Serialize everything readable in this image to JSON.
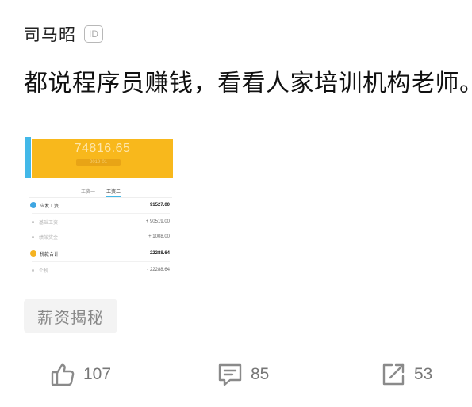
{
  "post": {
    "author": "司马昭",
    "id_badge": "ID",
    "text": "都说程序员赚钱，看看人家培训机构老师。",
    "tag": "薪资揭秘"
  },
  "image": {
    "amount": "74816.65",
    "date": "2019-01",
    "tabs": [
      "工资一",
      "工资二"
    ],
    "rows": [
      {
        "label": "应发工资",
        "value": "91527.00",
        "kind": "main",
        "icon": "blue"
      },
      {
        "label": "基础工资",
        "value": "+ 90519.00",
        "kind": "sub"
      },
      {
        "label": "绩效奖金",
        "value": "+ 1008.00",
        "kind": "sub"
      },
      {
        "label": "税款合计",
        "value": "22288.64",
        "kind": "main",
        "icon": "gold"
      },
      {
        "label": "个税",
        "value": "- 22288.64",
        "kind": "sub"
      }
    ]
  },
  "actions": {
    "likes": "107",
    "comments": "85",
    "shares": "53"
  },
  "colors": {
    "header_yellow": "#f8b81c",
    "accent_blue": "#42b8e8",
    "icon_gray": "#8a8a8a"
  }
}
